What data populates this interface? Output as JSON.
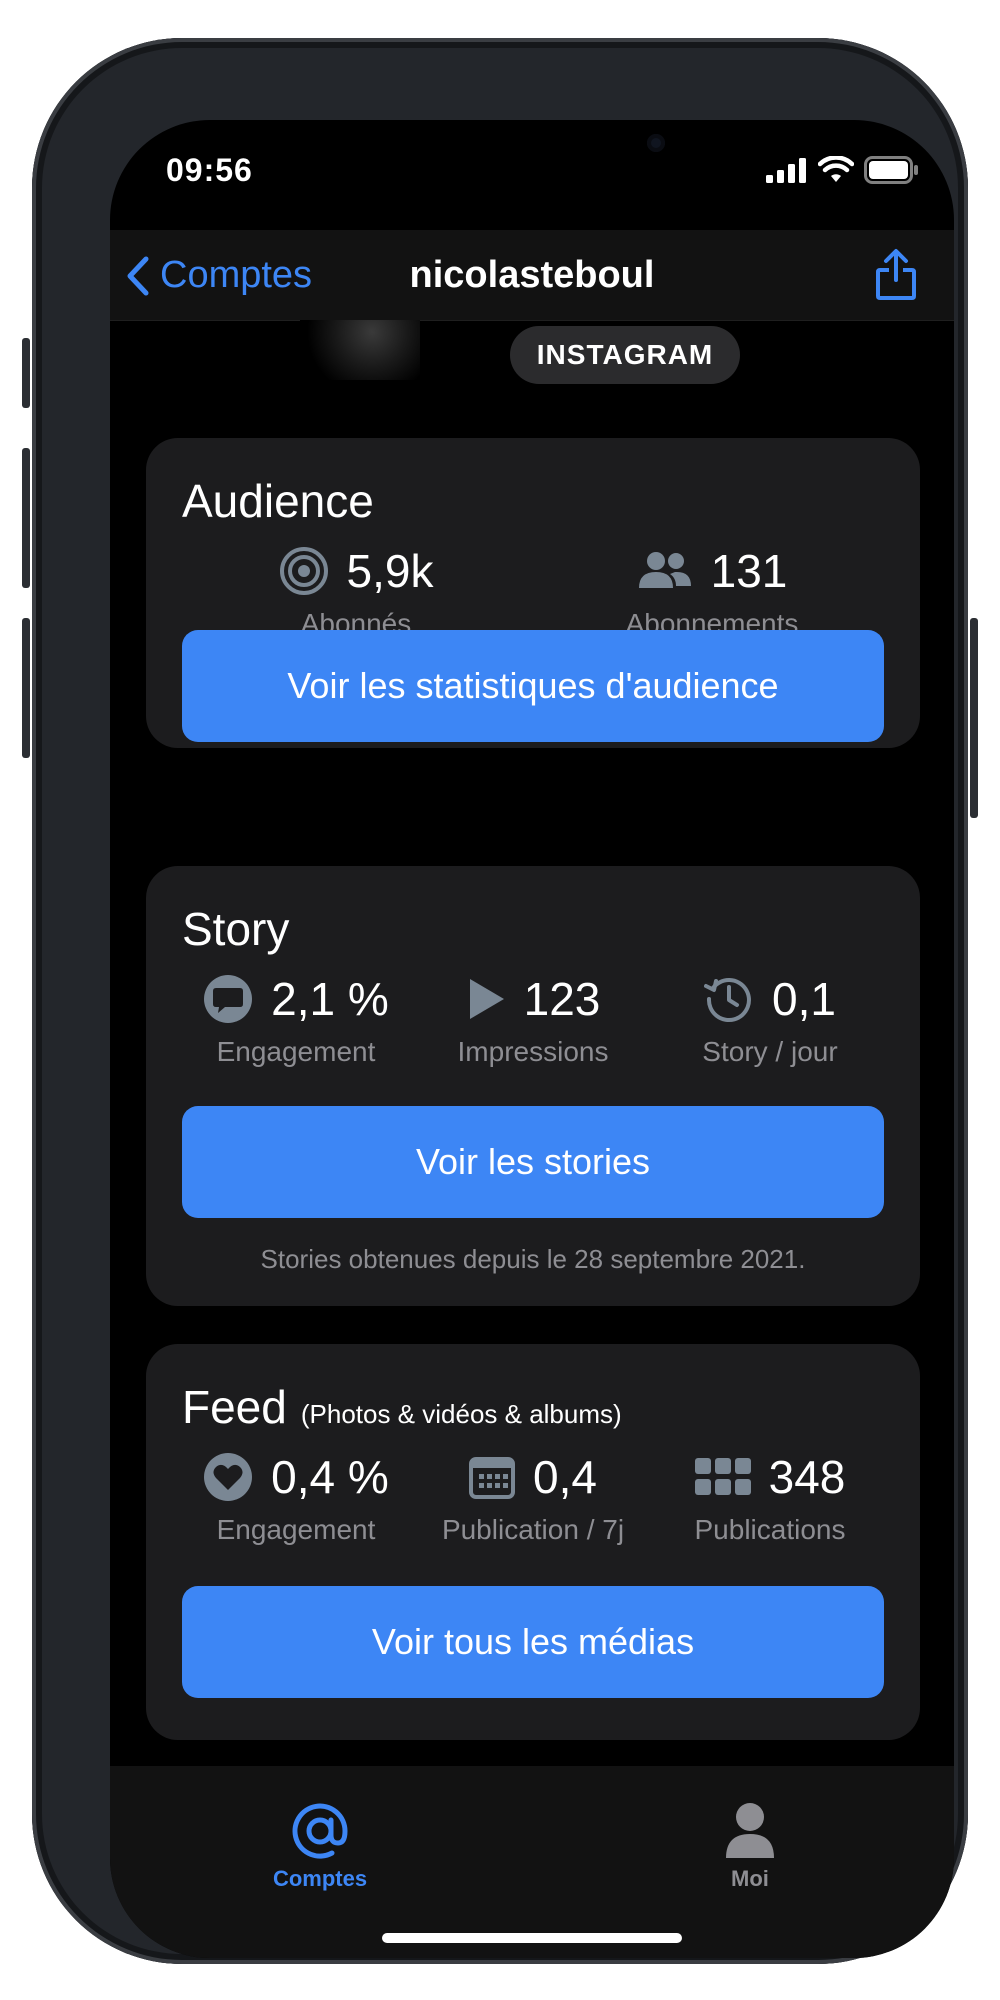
{
  "status": {
    "time": "09:56"
  },
  "nav": {
    "back_label": "Comptes",
    "title": "nicolasteboul",
    "share_icon": "share-icon"
  },
  "platform_badge": "INSTAGRAM",
  "audience": {
    "title": "Audience",
    "metrics": [
      {
        "icon": "target-icon",
        "value": "5,9k",
        "label": "Abonnés"
      },
      {
        "icon": "people-icon",
        "value": "131",
        "label": "Abonnements"
      }
    ],
    "button": "Voir les statistiques d'audience"
  },
  "story": {
    "title": "Story",
    "metrics": [
      {
        "icon": "chat-bubble-icon",
        "value": "2,1 %",
        "label": "Engagement"
      },
      {
        "icon": "play-icon",
        "value": "123",
        "label": "Impressions"
      },
      {
        "icon": "history-icon",
        "value": "0,1",
        "label": "Story / jour"
      }
    ],
    "button": "Voir les stories",
    "note": "Stories obtenues depuis le 28 septembre 2021."
  },
  "feed": {
    "title": "Feed",
    "subtitle": "(Photos & vidéos & albums)",
    "metrics": [
      {
        "icon": "heart-icon",
        "value": "0,4 %",
        "label": "Engagement"
      },
      {
        "icon": "calendar-icon",
        "value": "0,4",
        "label": "Publication / 7j"
      },
      {
        "icon": "grid-icon",
        "value": "348",
        "label": "Publications"
      }
    ],
    "button": "Voir tous les médias"
  },
  "tabbar": {
    "tabs": [
      {
        "icon": "at-sign-icon",
        "label": "Comptes",
        "active": true
      },
      {
        "icon": "person-icon",
        "label": "Moi",
        "active": false
      }
    ]
  },
  "colors": {
    "accent": "#3d86f5",
    "card": "#1c1c1e",
    "icon_gray": "#7a8794"
  }
}
